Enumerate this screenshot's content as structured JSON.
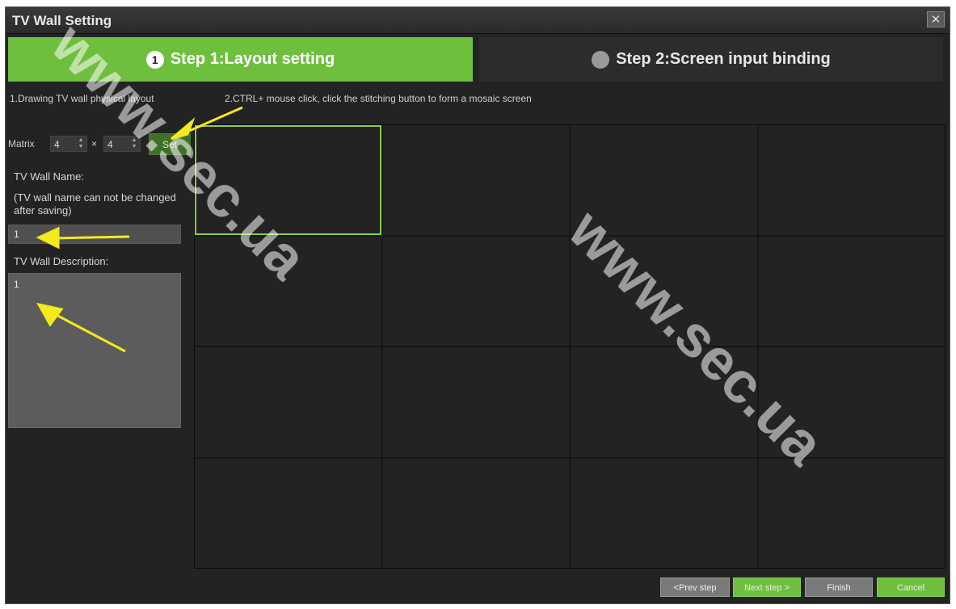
{
  "window": {
    "title": "TV Wall Setting",
    "close_icon": "close-icon"
  },
  "steps": [
    {
      "number": "1",
      "label": "Step 1:Layout setting",
      "active": true,
      "color": "#6fbf3f"
    },
    {
      "label": "Step 2:Screen input binding",
      "active": false
    }
  ],
  "hints": {
    "hint1": "1.Drawing TV wall physical layout",
    "hint2": "2.CTRL+ mouse click, click the stitching button to form a mosaic screen"
  },
  "matrix": {
    "label": "Matrix",
    "rows": "4",
    "times": "×",
    "cols": "4",
    "set_label": "Set"
  },
  "tv_wall_name": {
    "label": "TV Wall Name:",
    "note": "(TV wall name can not be changed after saving)",
    "value": "1"
  },
  "tv_wall_description": {
    "label": "TV Wall Description:",
    "value": "1"
  },
  "layout_grid": {
    "rows": 4,
    "cols": 4,
    "selected_cell": 0,
    "highlight_color": "#8ccf3a"
  },
  "footer": {
    "prev_label": "<Prev step",
    "next_label": "Next step >",
    "finish_label": "Finish",
    "cancel_label": "Cancel"
  },
  "watermark": "www.sec.ua"
}
